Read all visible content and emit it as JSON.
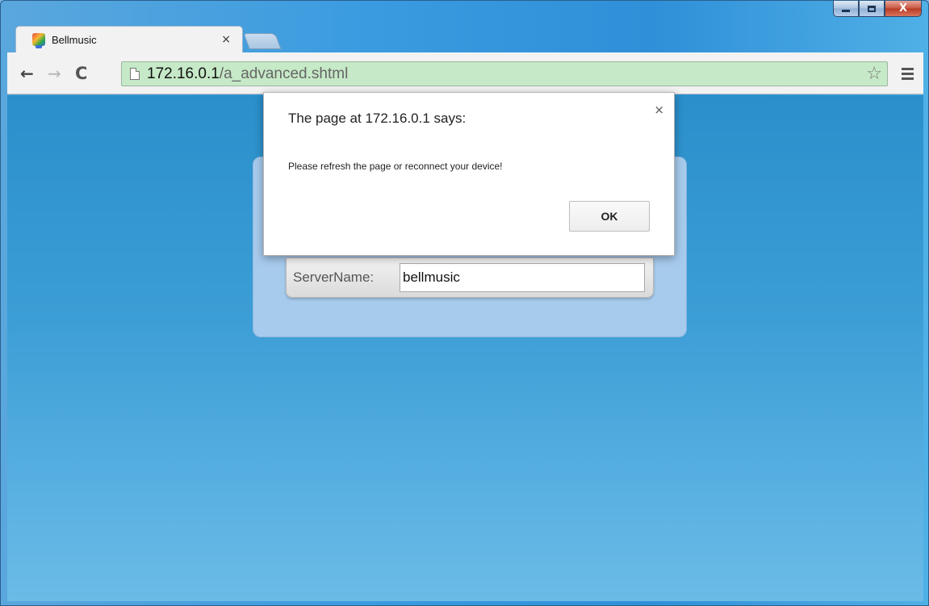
{
  "browser": {
    "tab": {
      "title": "Bellmusic",
      "close_glyph": "×",
      "favicon": "bellmusic-favicon"
    },
    "window_controls": {
      "minimize": "minimize-icon",
      "maximize": "maximize-icon",
      "close_glyph": "X"
    },
    "toolbar": {
      "back_glyph": "←",
      "forward_glyph": "→",
      "reload_glyph": "C",
      "address": {
        "host": "172.16.0.1",
        "path": "/a_advanced.shtml"
      },
      "bookmark_glyph": "☆",
      "omnibox_bg": "#c6e9c7"
    }
  },
  "page": {
    "server_name_label": "ServerName:",
    "server_name_value": "bellmusic"
  },
  "dialog": {
    "title": "The page at 172.16.0.1 says:",
    "close_glyph": "×",
    "message": "Please refresh the page or reconnect your device!",
    "ok_label": "OK"
  },
  "colors": {
    "content_top": "#2a8fcb",
    "content_bottom": "#6bbbe6",
    "panel": "#a7cbed"
  }
}
